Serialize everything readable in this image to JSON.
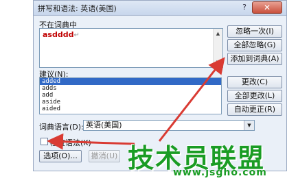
{
  "dialog": {
    "title": "拼写和语法: 英语(美国)",
    "help_glyph": "?",
    "close_glyph": "✕"
  },
  "not_in_dictionary": {
    "label": "不在词典中",
    "word": "asdddd",
    "para_mark": "↵"
  },
  "side_buttons": {
    "ignore_once": "忽略一次(I)",
    "ignore_all": "全部忽略(G)",
    "add_to_dictionary": "添加到词典(A)",
    "change": "更改(C)",
    "change_all": "全部更改(L)",
    "autocorrect": "自动更正(R)"
  },
  "suggestions": {
    "label": "建议(N):",
    "items": [
      "added",
      "adds",
      "add",
      "aside",
      "aided"
    ]
  },
  "dictionary_language": {
    "label": "词典语言(D):",
    "value": "英语(美国)"
  },
  "check_grammar": {
    "label": "检查语法(K)",
    "checked": false
  },
  "bottom_buttons": {
    "options": "选项(O)...",
    "undo": "撤消(U)"
  },
  "watermark": {
    "brand": "技术员联盟",
    "url": "www.jsgho.com"
  },
  "colors": {
    "arrow": "#d93b33",
    "watermark": "#1a9c24",
    "selection": "#3169c6",
    "error_word": "#c00000"
  }
}
